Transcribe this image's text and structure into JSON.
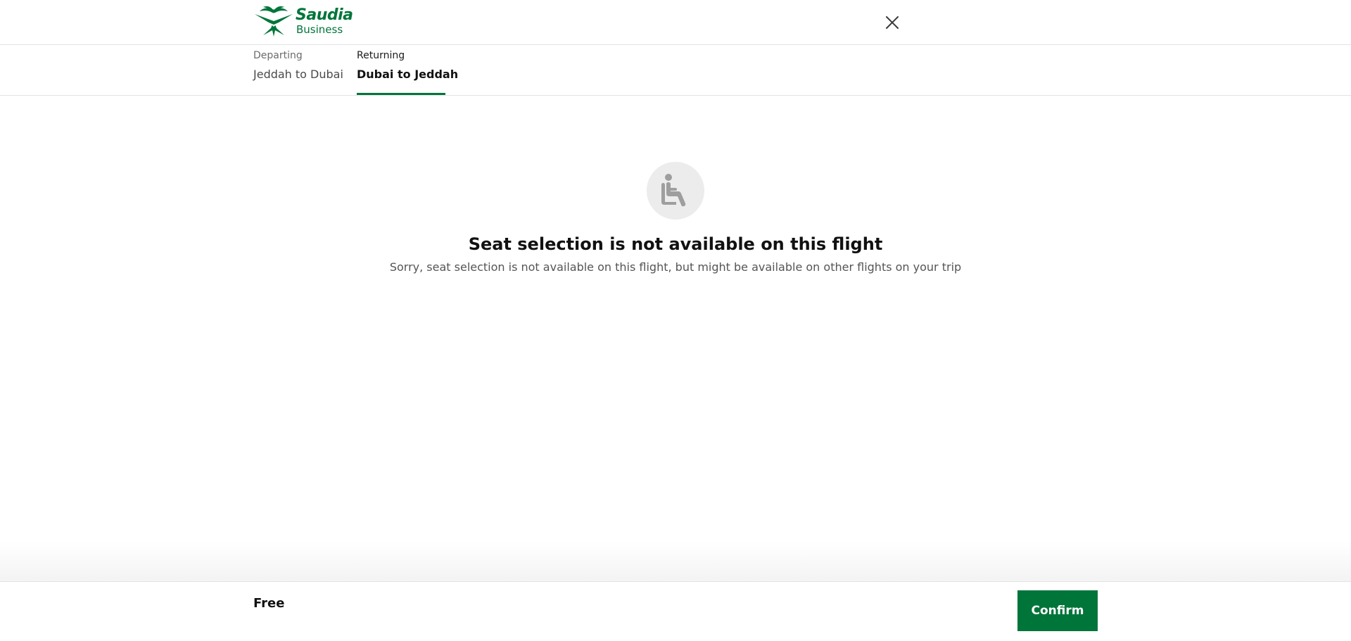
{
  "header": {
    "logo_brand": "Saudia",
    "logo_sub": "Business",
    "close_icon": "close-icon"
  },
  "tabs": [
    {
      "sub": "Departing",
      "main": "Jeddah to Dubai",
      "active": false
    },
    {
      "sub": "Returning",
      "main": "Dubai to Jeddah",
      "active": true
    }
  ],
  "empty_state": {
    "icon": "seat-icon",
    "title": "Seat selection is not available on this flight",
    "description": "Sorry, seat selection is not available on this flight, but might be available on other flights on your trip"
  },
  "footer": {
    "price": "Free",
    "confirm_label": "Confirm"
  },
  "colors": {
    "brand_green": "#00753a",
    "icon_gray": "#9e9e9e",
    "icon_bg": "#ececec"
  }
}
